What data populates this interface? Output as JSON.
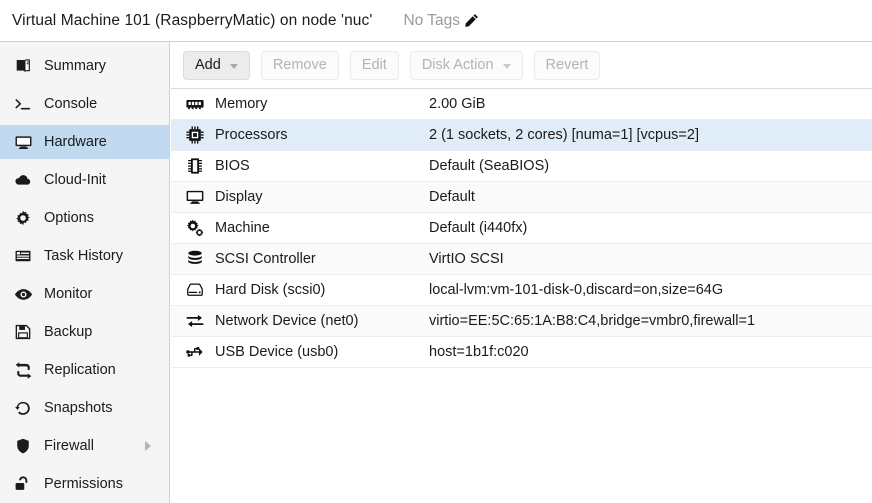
{
  "header": {
    "title": "Virtual Machine 101 (RaspberryMatic) on node 'nuc'",
    "tags_label": "No Tags",
    "edit_icon": "pencil-icon"
  },
  "sidebar": {
    "items": [
      {
        "label": "Summary",
        "icon": "book-icon",
        "selected": false,
        "has_arrow": false
      },
      {
        "label": "Console",
        "icon": "terminal-icon",
        "selected": false,
        "has_arrow": false
      },
      {
        "label": "Hardware",
        "icon": "monitor-icon",
        "selected": true,
        "has_arrow": false
      },
      {
        "label": "Cloud-Init",
        "icon": "cloud-icon",
        "selected": false,
        "has_arrow": false
      },
      {
        "label": "Options",
        "icon": "gear-icon",
        "selected": false,
        "has_arrow": false
      },
      {
        "label": "Task History",
        "icon": "list-icon",
        "selected": false,
        "has_arrow": false
      },
      {
        "label": "Monitor",
        "icon": "eye-icon",
        "selected": false,
        "has_arrow": false
      },
      {
        "label": "Backup",
        "icon": "floppy-disk-icon",
        "selected": false,
        "has_arrow": false
      },
      {
        "label": "Replication",
        "icon": "retweet-icon",
        "selected": false,
        "has_arrow": false
      },
      {
        "label": "Snapshots",
        "icon": "history-icon",
        "selected": false,
        "has_arrow": false
      },
      {
        "label": "Firewall",
        "icon": "shield-icon",
        "selected": false,
        "has_arrow": true
      },
      {
        "label": "Permissions",
        "icon": "unlock-icon",
        "selected": false,
        "has_arrow": false
      }
    ]
  },
  "toolbar": {
    "buttons": [
      {
        "label": "Add",
        "enabled": true,
        "has_chevron": true
      },
      {
        "label": "Remove",
        "enabled": false,
        "has_chevron": false
      },
      {
        "label": "Edit",
        "enabled": false,
        "has_chevron": false
      },
      {
        "label": "Disk Action",
        "enabled": false,
        "has_chevron": true
      },
      {
        "label": "Revert",
        "enabled": false,
        "has_chevron": false
      }
    ]
  },
  "hardware": {
    "rows": [
      {
        "key": "Memory",
        "value": "2.00 GiB",
        "icon": "memory-icon",
        "selected": false
      },
      {
        "key": "Processors",
        "value": "2 (1 sockets, 2 cores) [numa=1] [vcpus=2]",
        "icon": "cpu-icon",
        "selected": true
      },
      {
        "key": "BIOS",
        "value": "Default (SeaBIOS)",
        "icon": "microchip-icon",
        "selected": false
      },
      {
        "key": "Display",
        "value": "Default",
        "icon": "display-icon",
        "selected": false
      },
      {
        "key": "Machine",
        "value": "Default (i440fx)",
        "icon": "cogs-icon",
        "selected": false
      },
      {
        "key": "SCSI Controller",
        "value": "VirtIO SCSI",
        "icon": "database-icon",
        "selected": false
      },
      {
        "key": "Hard Disk (scsi0)",
        "value": "local-lvm:vm-101-disk-0,discard=on,size=64G",
        "icon": "harddisk-icon",
        "selected": false
      },
      {
        "key": "Network Device (net0)",
        "value": "virtio=EE:5C:65:1A:B8:C4,bridge=vmbr0,firewall=1",
        "icon": "exchange-icon",
        "selected": false
      },
      {
        "key": "USB Device (usb0)",
        "value": "host=1b1f:c020",
        "icon": "usb-icon",
        "selected": false
      }
    ]
  },
  "colors": {
    "row_selected": "#e0ecf7",
    "nav_selected": "#c1daf0",
    "sidebar_bg": "#f5f5f5",
    "row_alt": "#fafafa",
    "border": "#d0d0d0"
  }
}
